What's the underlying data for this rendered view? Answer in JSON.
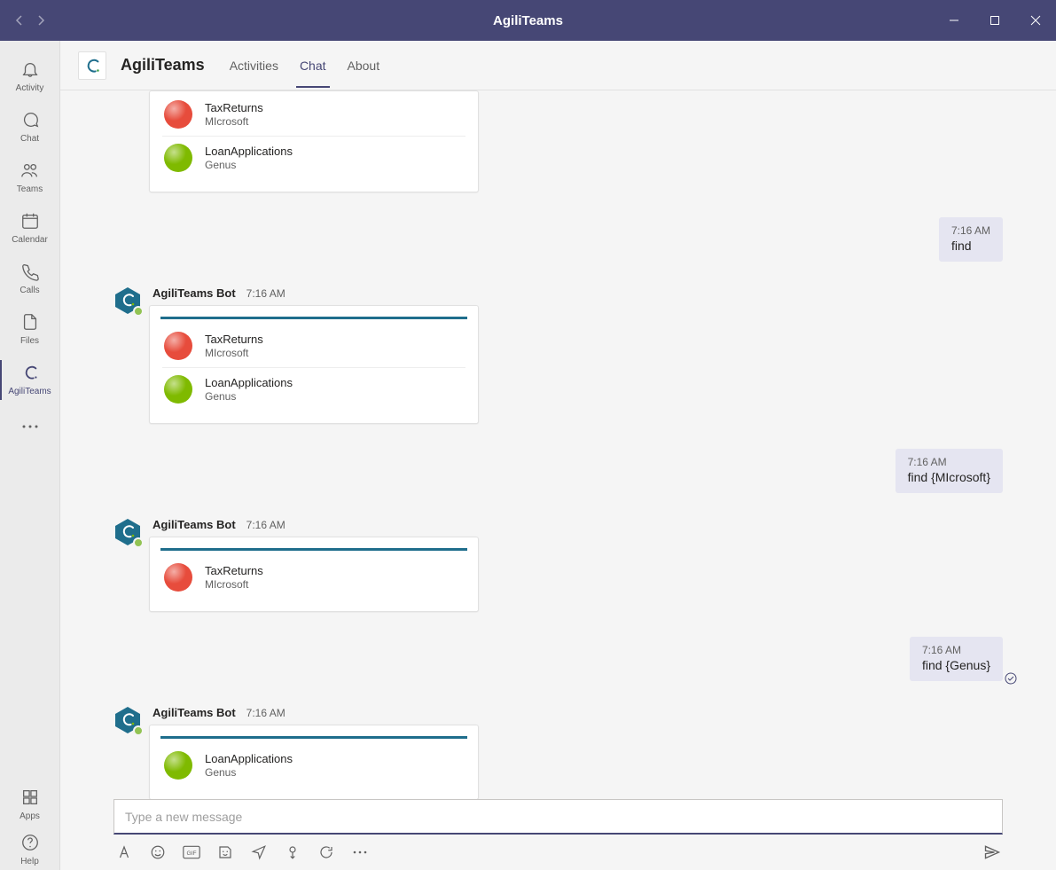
{
  "window": {
    "title": "AgiliTeams"
  },
  "sidebar": {
    "items": [
      {
        "label": "Activity"
      },
      {
        "label": "Chat"
      },
      {
        "label": "Teams"
      },
      {
        "label": "Calendar"
      },
      {
        "label": "Calls"
      },
      {
        "label": "Files"
      },
      {
        "label": "AgiliTeams"
      }
    ],
    "bottom": [
      {
        "label": "Apps"
      },
      {
        "label": "Help"
      }
    ]
  },
  "header": {
    "appName": "AgiliTeams",
    "tabs": [
      {
        "label": "Activities"
      },
      {
        "label": "Chat"
      },
      {
        "label": "About"
      }
    ]
  },
  "conversation": {
    "botName": "AgiliTeams Bot",
    "messages": [
      {
        "type": "bot_card_continuation",
        "items": [
          {
            "title": "TaxReturns",
            "subtitle": "MIcrosoft",
            "color": "red"
          },
          {
            "title": "LoanApplications",
            "subtitle": "Genus",
            "color": "green"
          }
        ]
      },
      {
        "type": "user",
        "time": "7:16 AM",
        "text": "find"
      },
      {
        "type": "bot_card",
        "time": "7:16 AM",
        "items": [
          {
            "title": "TaxReturns",
            "subtitle": "MIcrosoft",
            "color": "red"
          },
          {
            "title": "LoanApplications",
            "subtitle": "Genus",
            "color": "green"
          }
        ]
      },
      {
        "type": "user",
        "time": "7:16 AM",
        "text": "find {MIcrosoft}"
      },
      {
        "type": "bot_card",
        "time": "7:16 AM",
        "items": [
          {
            "title": "TaxReturns",
            "subtitle": "MIcrosoft",
            "color": "red"
          }
        ]
      },
      {
        "type": "user",
        "time": "7:16 AM",
        "text": "find {Genus}",
        "seen": true
      },
      {
        "type": "bot_card",
        "time": "7:16 AM",
        "items": [
          {
            "title": "LoanApplications",
            "subtitle": "Genus",
            "color": "green"
          }
        ]
      }
    ]
  },
  "compose": {
    "placeholder": "Type a new message"
  }
}
